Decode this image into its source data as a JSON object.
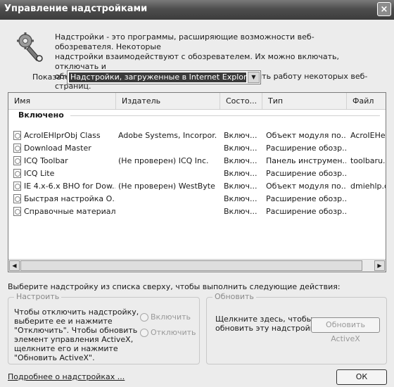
{
  "window": {
    "title": "Управление надстройками",
    "close_glyph": "×"
  },
  "intro_lines": [
    "Надстройки - это программы, расширяющие возможности веб-обозревателя. Некоторые",
    "надстройки взаимодействуют с обозревателем. Их можно включать, отключать и",
    "обновлять. Отключение надстроек может нарушить работу некоторых веб-страниц."
  ],
  "show": {
    "label": "Показать:",
    "selected": "Надстройки, загруженные в Internet Explorer"
  },
  "table": {
    "columns": [
      "Имя",
      "Издатель",
      "Состо...",
      "Тип",
      "Файл"
    ],
    "group": "Включено",
    "rows": [
      {
        "name": "AcroIEHlprObj Class",
        "publisher": "Adobe Systems, Incorpor...",
        "status": "Включ...",
        "type": "Объект модуля по...",
        "file": "AcroIEHelp"
      },
      {
        "name": "Download Master",
        "publisher": "",
        "status": "Включ...",
        "type": "Расширение обозр...",
        "file": ""
      },
      {
        "name": "ICQ  Toolbar",
        "publisher": "(Не проверен) ICQ Inc.",
        "status": "Включ...",
        "type": "Панель инструмен...",
        "file": "toolbaru.d"
      },
      {
        "name": "ICQ Lite",
        "publisher": "",
        "status": "Включ...",
        "type": "Расширение обозр...",
        "file": ""
      },
      {
        "name": "IE 4.x-6.x BHO for Dow...",
        "publisher": "(Не проверен) WestByte",
        "status": "Включ...",
        "type": "Объект модуля по...",
        "file": "dmiehlp.dll"
      },
      {
        "name": "Быстрая настройка О...",
        "publisher": "",
        "status": "Включ...",
        "type": "Расширение обозр...",
        "file": ""
      },
      {
        "name": "Справочные материалы",
        "publisher": "",
        "status": "Включ...",
        "type": "Расширение обозр...",
        "file": ""
      }
    ]
  },
  "hint": "Выберите надстройку из списка сверху, чтобы выполнить следующие действия:",
  "configure": {
    "legend": "Настроить",
    "text_lines": [
      "Чтобы отключить надстройку,",
      "выберите ее и нажмите",
      "\"Отключить\". Чтобы обновить",
      "элемент управления ActiveX,",
      "щелкните его и нажмите",
      "\"Обновить ActiveX\"."
    ],
    "enable_label": "Включить",
    "disable_label": "Отключить"
  },
  "update": {
    "legend": "Обновить",
    "text_lines": [
      "Щелкните здесь, чтобы",
      "обновить эту надстройку"
    ],
    "button": "Обновить ActiveX"
  },
  "more_link": "Подробнее о надстройках ...",
  "ok_button": "ОК"
}
